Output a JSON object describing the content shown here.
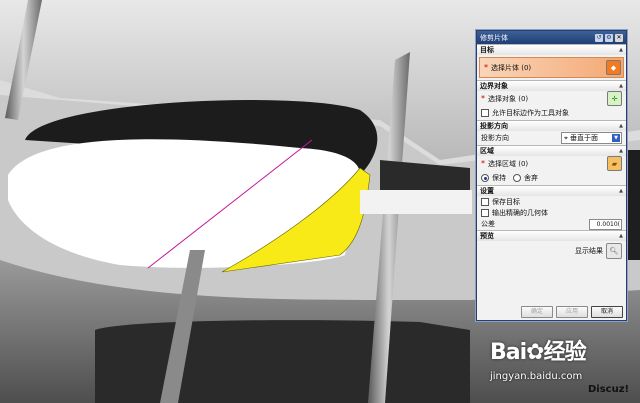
{
  "dialog": {
    "title": "修剪片体",
    "sections": {
      "target": {
        "header": "目标",
        "select_label": "选择片体 (0)"
      },
      "boundary": {
        "header": "边界对象",
        "select_label": "选择对象 (0)",
        "allow_tool": "允许目标边作为工具对象"
      },
      "projection": {
        "header": "投影方向",
        "label": "投影方向",
        "value": "垂直于面"
      },
      "region": {
        "header": "区域",
        "select_label": "选择区域 (0)",
        "keep": "保持",
        "discard": "舍弃"
      },
      "settings": {
        "header": "设置",
        "save_target": "保存目标",
        "output_exact": "输出精确的几何体",
        "tolerance_label": "公差",
        "tolerance_value": "0.0010("
      },
      "preview": {
        "header": "预览",
        "show_result": "显示结果"
      }
    },
    "buttons": {
      "ok": "确定",
      "apply": "应用",
      "cancel": "取消"
    }
  },
  "watermark": {
    "logo": "Bai",
    "logo_cn": "经验",
    "url": "jingyan.baidu.com",
    "discuz": "Discuz!"
  },
  "colors": {
    "highlight_region": "#f7ea17",
    "projection_line": "#c2189a",
    "titlebar": "#2a4a85"
  }
}
